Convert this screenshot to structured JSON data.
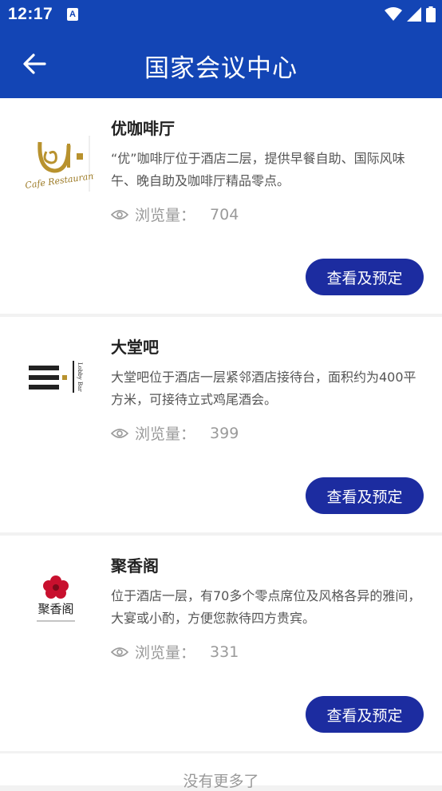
{
  "status": {
    "time": "12:17",
    "notif_icon": "a-notification-icon"
  },
  "appbar": {
    "title": "国家会议中心",
    "back_icon": "arrow-left-icon"
  },
  "venues": [
    {
      "title": "优咖啡厅",
      "description": "“优”咖啡厅位于酒店二层，提供早餐自助、国际风味午、晚自助及咖啡厅精品零点。",
      "views_label": "浏览量：",
      "views": "704",
      "button": "查看及预定",
      "logo_text": "Cafe Restaurant"
    },
    {
      "title": "大堂吧",
      "description": "大堂吧位于酒店一层紧邻酒店接待台，面积约为400平方米，可接待立式鸡尾酒会。",
      "views_label": "浏览量：",
      "views": "399",
      "button": "查看及预定",
      "logo_text": "Lobby Bar"
    },
    {
      "title": "聚香阁",
      "description": "位于酒店一层，有70多个零点席位及风格各异的雅间，大宴或小酌，方便您款待四方贵宾。",
      "views_label": "浏览量：",
      "views": "331",
      "button": "查看及预定",
      "logo_text": "聚香阁"
    }
  ],
  "footer": {
    "text": "没有更多了"
  },
  "colors": {
    "primary": "#1345b5",
    "button": "#1c2ca0"
  }
}
